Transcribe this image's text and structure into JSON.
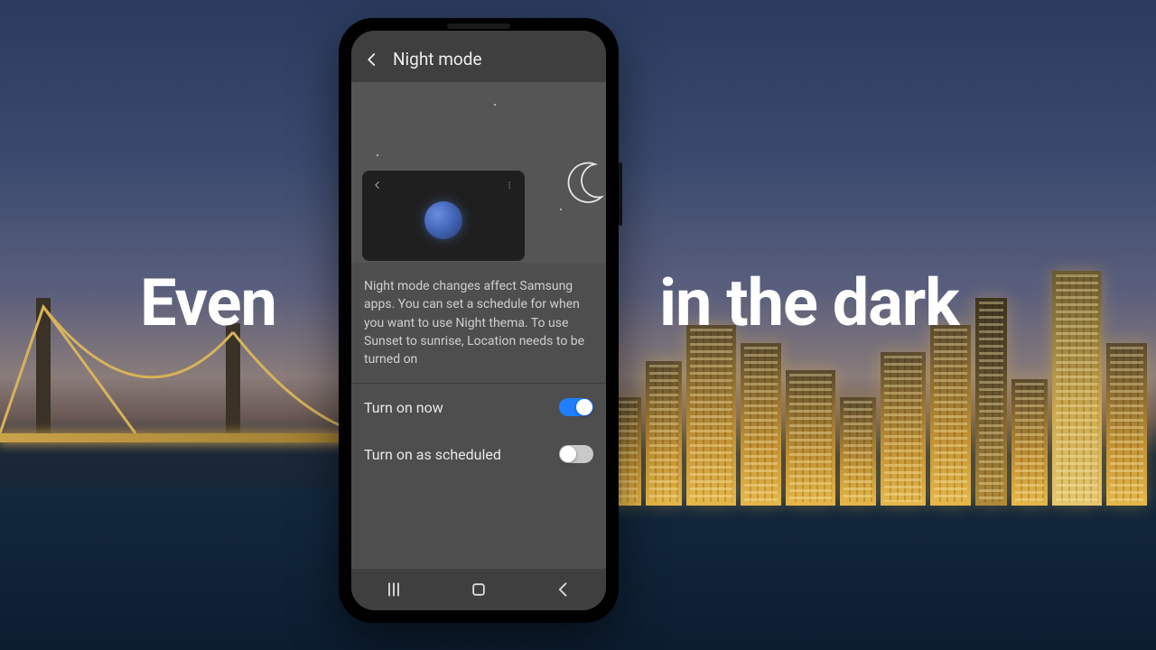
{
  "tagline": {
    "left": "Even",
    "right": "in the dark"
  },
  "screen": {
    "header": {
      "title": "Night mode"
    },
    "description": "Night mode changes affect Samsung apps. You can set a schedule for when you want to use Night thema. To use Sunset to sunrise, Location needs to be turned on",
    "settings": [
      {
        "label": "Turn on now",
        "on": true
      },
      {
        "label": "Turn on as scheduled",
        "on": false
      }
    ]
  },
  "colors": {
    "accent": "#1f7fff"
  }
}
